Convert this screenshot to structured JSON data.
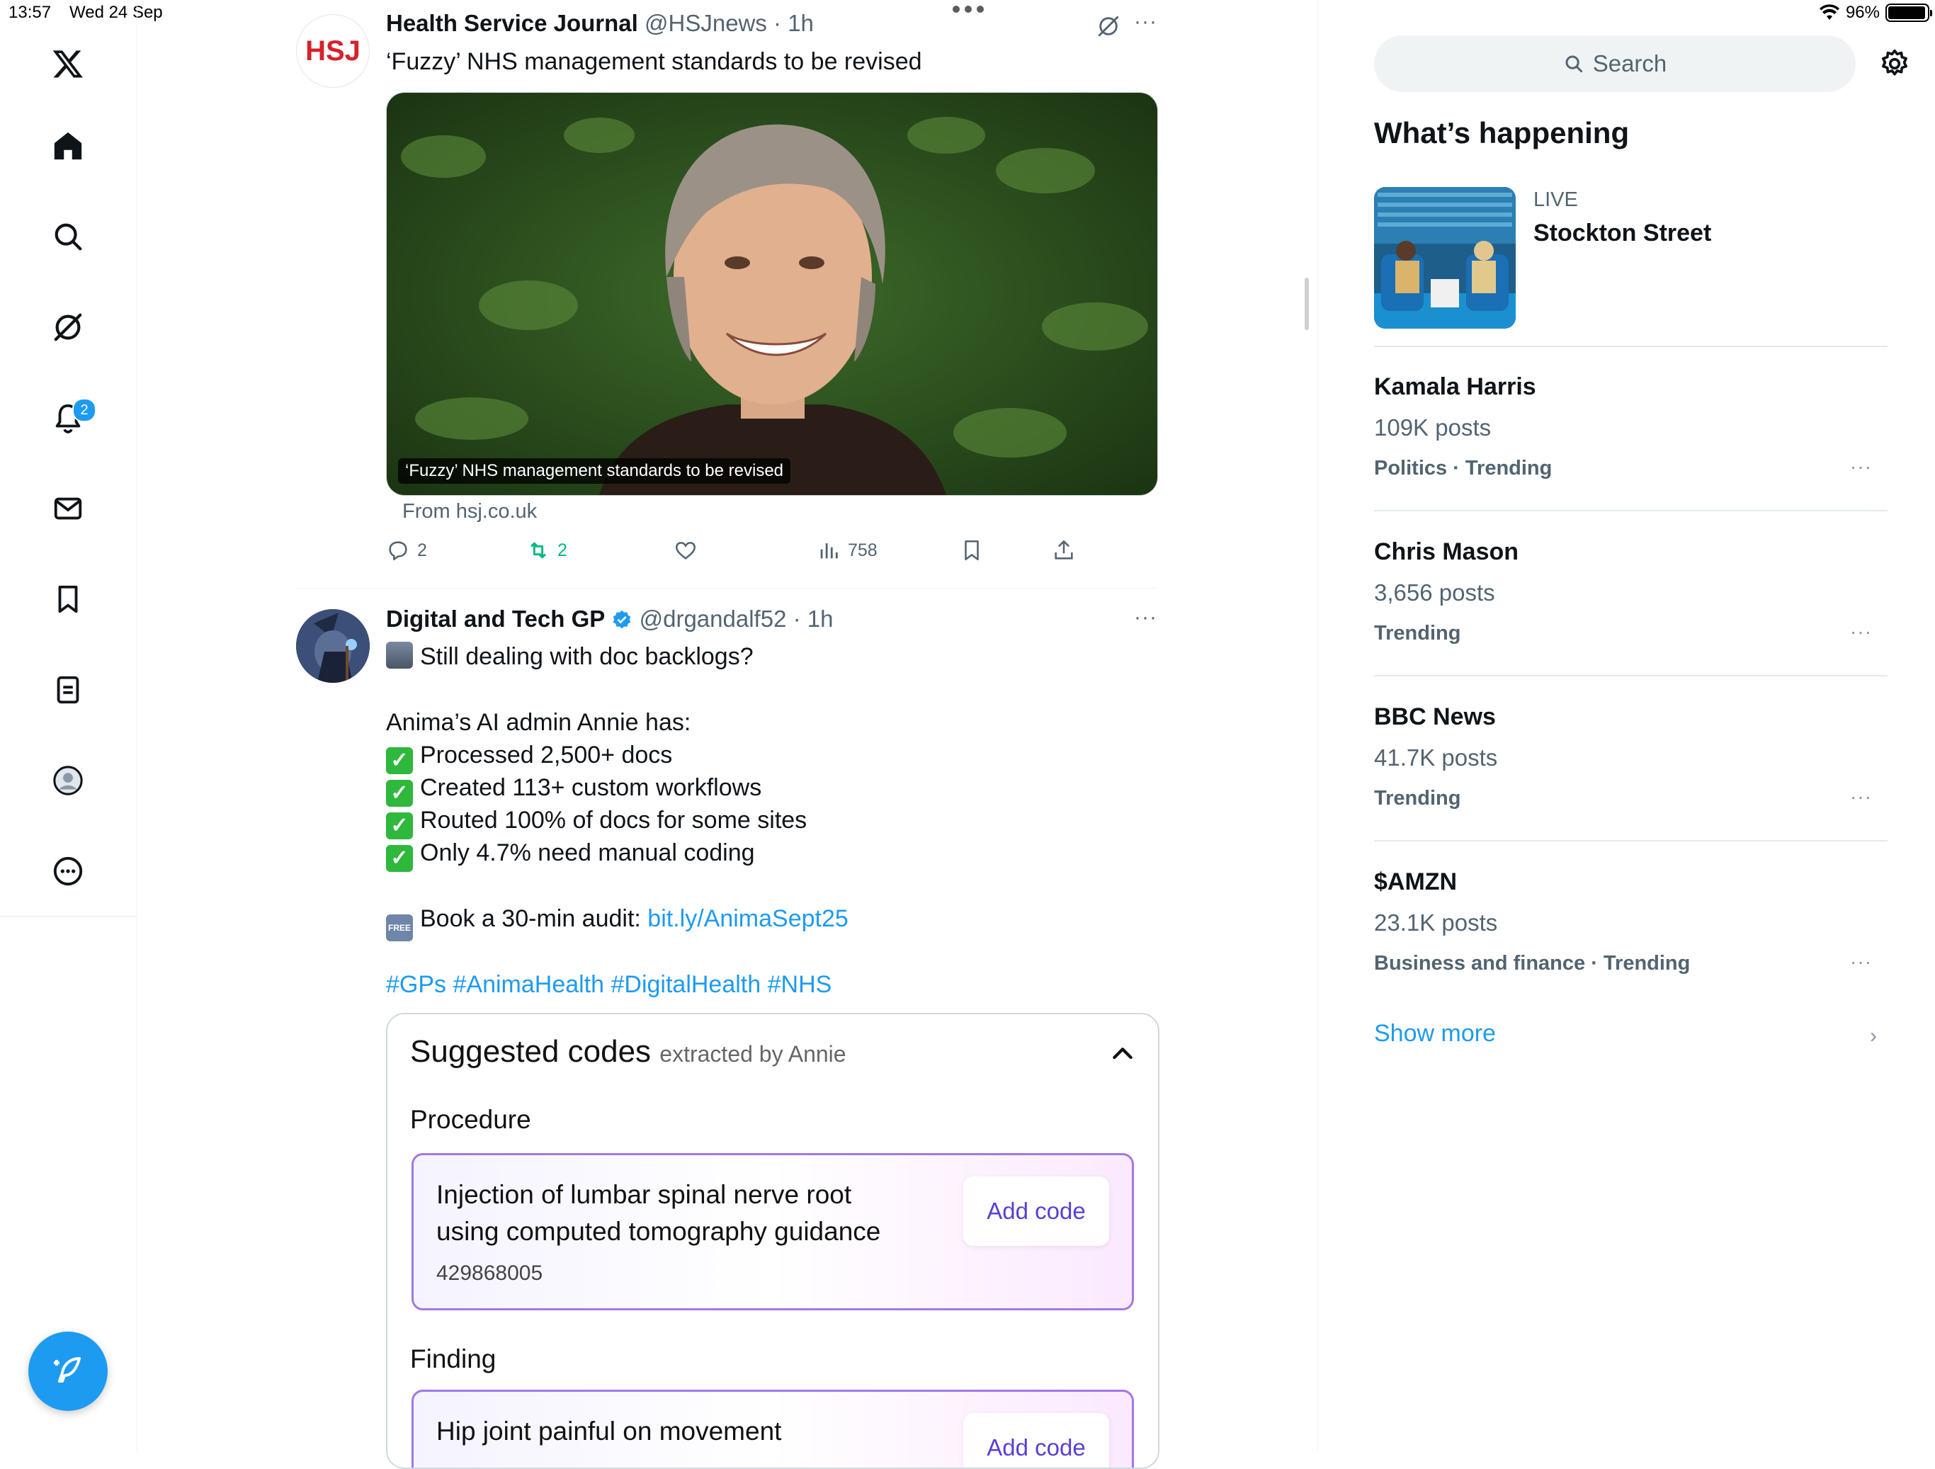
{
  "status": {
    "time": "13:57",
    "date": "Wed 24 Sep",
    "battery": "96%",
    "battery_level": 0.96
  },
  "nav": {
    "notification_count": "2",
    "items": [
      "home-icon",
      "search-icon",
      "grok-icon",
      "notifications-icon",
      "messages-icon",
      "bookmarks-icon",
      "lists-icon",
      "profile-icon",
      "more-icon"
    ]
  },
  "tweets": [
    {
      "name": "Health Service Journal",
      "meta": "@HSJnews · 1h",
      "avatar_text": "HSJ",
      "text": "‘Fuzzy’ NHS management standards to be revised",
      "card_caption": "‘Fuzzy’ NHS management standards to be revised",
      "from": "From hsj.co.uk",
      "replies": "2",
      "reposts": "2",
      "views": "758"
    },
    {
      "name": "Digital and Tech GP",
      "meta": "@drgandalf52 · 1h",
      "lines": [
        "Still dealing with doc backlogs?",
        "Anima’s AI admin Annie has:",
        "Processed 2,500+ docs",
        "Created 113+ custom workflows",
        "Routed 100% of docs for some sites",
        "Only 4.7% need manual coding"
      ],
      "audit_prefix": "Book a 30-min audit: ",
      "audit_link": "bit.ly/AnimaSept25",
      "hashtags": "#GPs #AnimaHealth #DigitalHealth #NHS",
      "free_badge": "FREE",
      "codes": {
        "title": "Suggested codes",
        "subtitle": "extracted by Annie",
        "procedure_label": "Procedure",
        "procedure_line1": "Injection of lumbar spinal nerve root",
        "procedure_line2": "using computed tomography guidance",
        "procedure_code": "429868005",
        "add_code": "Add code",
        "finding_label": "Finding",
        "finding_text": "Hip joint painful on movement"
      }
    }
  ],
  "sidebar": {
    "search_placeholder": "Search",
    "heading": "What’s happening",
    "live_label": "LIVE",
    "live_title": "Stockton Street",
    "trends": [
      {
        "title": "Kamala Harris",
        "posts": "109K posts",
        "category": "Politics · Trending"
      },
      {
        "title": "Chris Mason",
        "posts": "3,656 posts",
        "category": "Trending"
      },
      {
        "title": "BBC News",
        "posts": "41.7K posts",
        "category": "Trending"
      },
      {
        "title": "$AMZN",
        "posts": "23.1K posts",
        "category": "Business and finance · Trending"
      }
    ],
    "show_more": "Show more"
  },
  "colors": {
    "accent": "#1d9bf0",
    "repost": "#00ba7c",
    "code_border": "#a278e3",
    "add_code": "#5a3fd6"
  }
}
